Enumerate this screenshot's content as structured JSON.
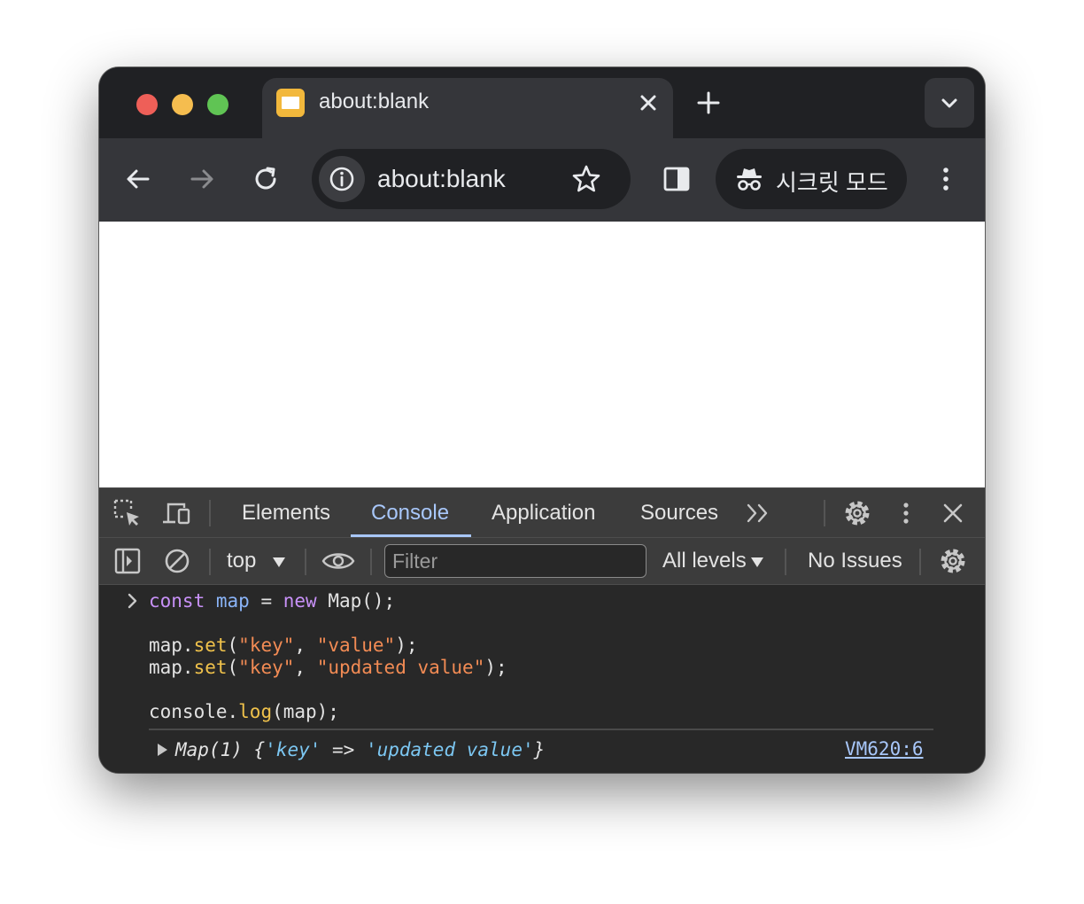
{
  "tab": {
    "title": "about:blank"
  },
  "toolbar": {
    "url": "about:blank",
    "incognito_label": "시크릿 모드"
  },
  "devtools": {
    "tabs": [
      {
        "label": "Elements",
        "active": false
      },
      {
        "label": "Console",
        "active": true
      },
      {
        "label": "Application",
        "active": false
      },
      {
        "label": "Sources",
        "active": false
      }
    ],
    "console_toolbar": {
      "context": "top",
      "filter_placeholder": "Filter",
      "levels": "All levels",
      "issues": "No Issues"
    },
    "code": {
      "line1": {
        "const": "const",
        "map": "map",
        "eq": " = ",
        "new": "new",
        "rest": " Map();"
      },
      "line2": {
        "map": "map.",
        "set": "set",
        "open": "(",
        "key": "\"key\"",
        "comma": ", ",
        "value": "\"value\"",
        "close": ");"
      },
      "line3": {
        "map": "map.",
        "set": "set",
        "open": "(",
        "key": "\"key\"",
        "comma": ", ",
        "value": "\"updated value\"",
        "close": ");"
      },
      "line4": {
        "console": "console.",
        "log": "log",
        "rest": "(map);"
      }
    },
    "result": {
      "prefix": "Map(1) {",
      "key": "'key'",
      "arrow": " => ",
      "value": "'updated value'",
      "suffix": "}",
      "source": "VM620:6"
    }
  },
  "colors": {
    "keyword": "#c891f8",
    "variable": "#8ab4f8",
    "function": "#f0c24b",
    "string": "#f28b54",
    "result_string": "#7cc7f2",
    "link": "#a8c7fa"
  }
}
